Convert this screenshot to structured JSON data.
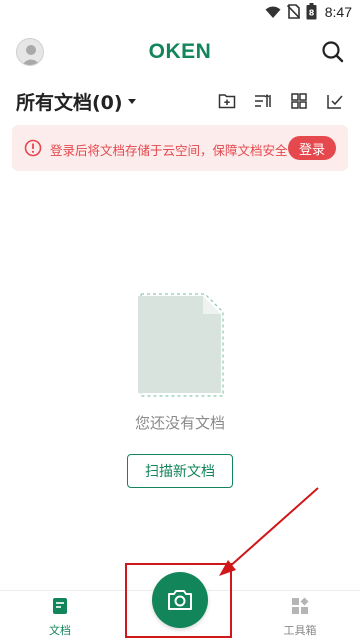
{
  "status_bar": {
    "time": "8:47",
    "battery_level": "8"
  },
  "header": {
    "title": "OKEN"
  },
  "title_row": {
    "title": "所有文档(0)"
  },
  "banner": {
    "message": "登录后将文档存储于云空间，保障文档安全",
    "login_label": "登录"
  },
  "empty_state": {
    "text": "您还没有文档",
    "scan_label": "扫描新文档"
  },
  "bottom_nav": {
    "docs_label": "文档",
    "tools_label": "工具箱"
  },
  "icons": {
    "search": "search-icon",
    "new_folder": "new-folder-icon",
    "sort": "sort-icon",
    "grid": "grid-view-icon",
    "select": "multi-select-icon",
    "camera": "camera-icon"
  },
  "colors": {
    "brand": "#13855a",
    "alert": "#e5484d",
    "alert_bg": "#fdecec",
    "annotation": "#d0181b"
  }
}
